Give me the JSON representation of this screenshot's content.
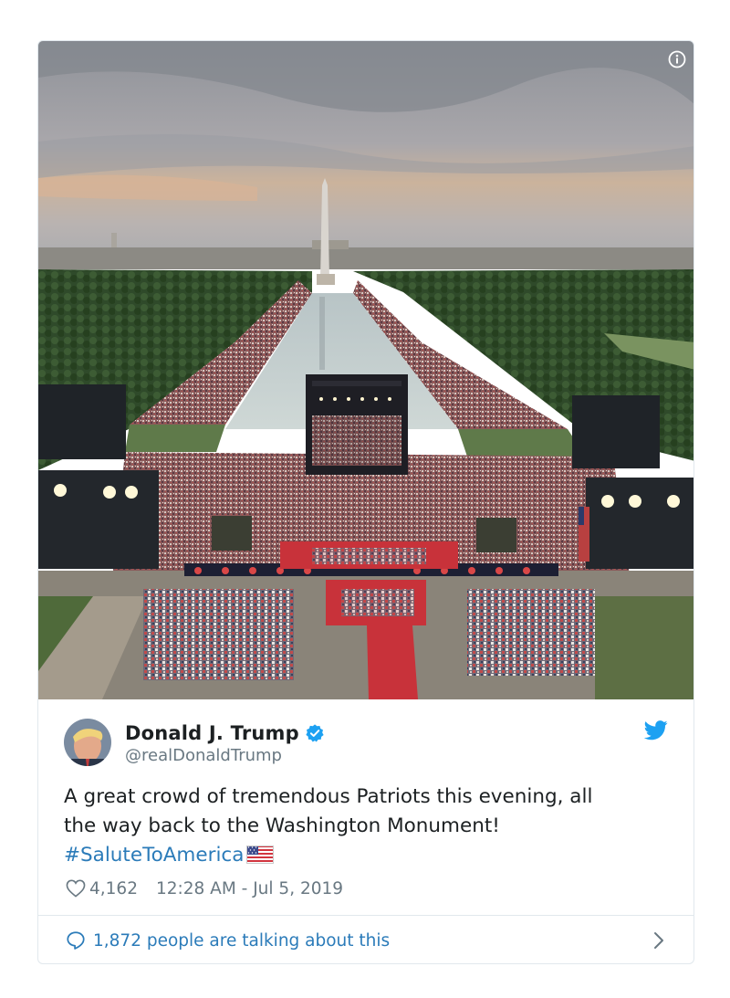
{
  "tweet": {
    "author_name": "Donald J. Trump",
    "handle": "@realDonaldTrump",
    "text_line1": "A great crowd of tremendous Patriots this evening, all",
    "text_line2": "the way back to the Washington Monument!",
    "hashtag": "#SaluteToAmerica",
    "likes": "4,162",
    "timestamp": "12:28 AM - Jul 5, 2019",
    "talking_label": "1,872 people are talking about this"
  },
  "colors": {
    "link": "#2b7bb9",
    "meta_text": "#697882",
    "twitter_blue": "#1da1f2",
    "border": "#e1e8ed"
  },
  "icons": {
    "info": "info-icon",
    "verified": "verified-badge-icon",
    "twitter": "twitter-bird-icon",
    "like": "heart-icon",
    "reply": "speech-bubble-icon",
    "more": "chevron-right-icon",
    "flag": "us-flag-icon"
  }
}
